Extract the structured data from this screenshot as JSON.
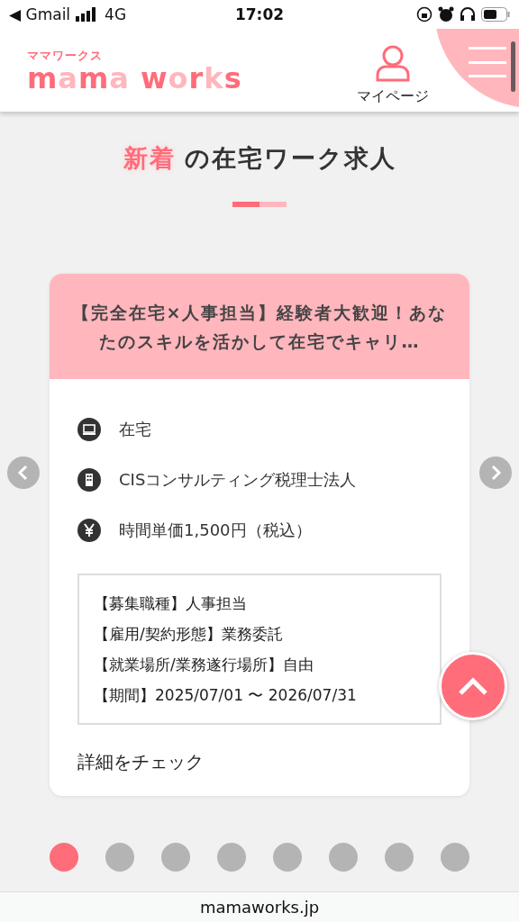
{
  "status_bar": {
    "back": "◀ Gmail",
    "network": "4G",
    "time": "17:02"
  },
  "header": {
    "logo_small": "ママワークス",
    "logo": "mama works",
    "mypage": "マイページ"
  },
  "section": {
    "title_highlight": "新着",
    "title_rest": "の在宅ワーク求人"
  },
  "card": {
    "title": "【完全在宅×人事担当】経験者大歓迎！あなたのスキルを活かして在宅でキャリ…",
    "info": [
      {
        "kind": "location",
        "text": "在宅"
      },
      {
        "kind": "company",
        "text": "CISコンサルティング税理士法人"
      },
      {
        "kind": "pay",
        "text": "時間単価1,500円（税込）"
      }
    ],
    "details": [
      "【募集職種】人事担当",
      "【雇用/契約形態】業務委託",
      "【就業場所/業務遂行場所】自由",
      "【期間】2025/07/01 〜 2026/07/31"
    ],
    "link": "詳細をチェック"
  },
  "pagination": [
    {
      "selected": true
    },
    {
      "selected": false
    },
    {
      "selected": false
    },
    {
      "selected": false
    },
    {
      "selected": false
    },
    {
      "selected": false
    },
    {
      "selected": false
    },
    {
      "selected": false
    }
  ],
  "url_bar": {
    "url": "mamaworks.jp"
  }
}
